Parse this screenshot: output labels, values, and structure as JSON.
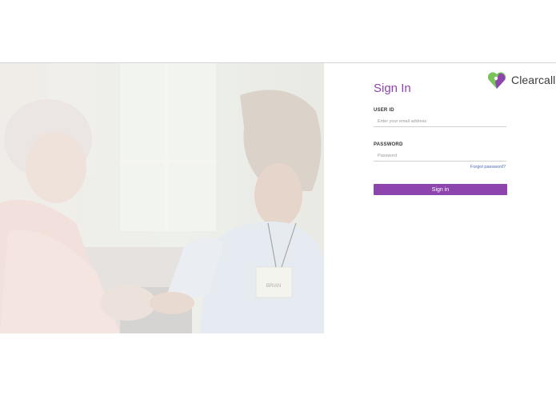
{
  "brand": {
    "name": "Clearcall",
    "accent": "#8e44ad",
    "logo_green": "#7ac35a"
  },
  "form": {
    "title": "Sign In",
    "user_id": {
      "label": "USER ID",
      "placeholder": "Enter your email address",
      "value": ""
    },
    "password": {
      "label": "PASSWORD",
      "placeholder": "Password",
      "value": ""
    },
    "forgot_link": "Forgot password?",
    "submit_label": "Sign in"
  },
  "photo": {
    "badge_text": "BRIAN"
  },
  "icons": {
    "logo": "heart-logo-icon"
  }
}
